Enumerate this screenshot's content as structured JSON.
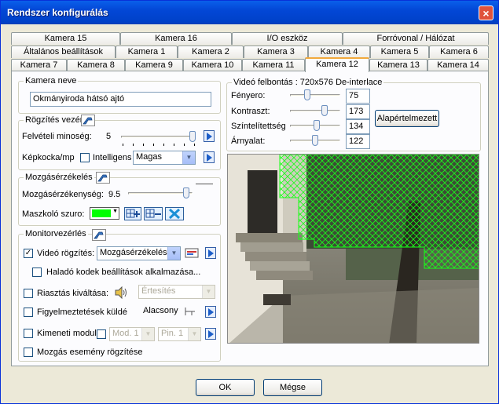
{
  "window": {
    "title": "Rendszer konfigurálás",
    "close": "×"
  },
  "tabs": {
    "row1": [
      "Kamera 15",
      "Kamera 16",
      "I/O eszköz",
      "Forróvonal / Hálózat"
    ],
    "row2": [
      "Általános beállítások",
      "Kamera 1",
      "Kamera 2",
      "Kamera 3",
      "Kamera 4",
      "Kamera 5",
      "Kamera 6"
    ],
    "row3": [
      "Kamera 7",
      "Kamera 8",
      "Kamera 9",
      "Kamera 10",
      "Kamera 11",
      "Kamera 12",
      "Kamera 13",
      "Kamera 14"
    ],
    "active": "Kamera 12"
  },
  "camera_name": {
    "label": "Kamera neve",
    "value": "Okmányiroda hátsó ajtó"
  },
  "recording": {
    "label": "Rögzítés vezér",
    "quality_label": "Felvételi minoség:",
    "quality_value": "5",
    "quality_level": 1.0,
    "fps_label": "Képkocka/mp",
    "intelligent_label": "Intelligens",
    "intelligent_checked": false,
    "fps_value": "Magas"
  },
  "motion": {
    "label": "Mozgásérzékelés",
    "sensitivity_label": "Mozgásérzékenység:",
    "sensitivity_value": "9.5",
    "sensitivity_level": 0.95,
    "mask_label": "Maszkoló szuro:",
    "mask_color": "#00ff00"
  },
  "monitor": {
    "label": "Monitorvezérlés",
    "video_rec_label": "Videó rögzítés:",
    "video_rec_checked": true,
    "video_rec_value": "Mozgásérzékelés",
    "advanced_label": "Haladó kodek beállítások alkalmazása...",
    "advanced_checked": false,
    "alarm_label": "Riasztás kiváltása:",
    "alarm_checked": false,
    "alarm_value": "Értesítés",
    "warnings_label": "Figyelmeztetések küldé",
    "warnings_checked": false,
    "warnings_level": "Alacsony",
    "output_label": "Kimeneti modul:",
    "output_checked": false,
    "output_mod": "Mod. 1",
    "output_pin": "Pin. 1",
    "motion_event_label": "Mozgás esemény rögzítése",
    "motion_event_checked": false
  },
  "video": {
    "resolution_label": "Videó felbontás : 720x576 De-interlace",
    "brightness_label": "Fényero:",
    "brightness_value": "75",
    "contrast_label": "Kontraszt:",
    "contrast_value": "173",
    "saturation_label": "Színtelítettség",
    "saturation_value": "134",
    "hue_label": "Árnyalat:",
    "hue_value": "122",
    "default_button": "Alapértelmezett"
  },
  "buttons": {
    "ok": "OK",
    "cancel": "Mégse"
  },
  "colors": {
    "titlebar": "#0347d6",
    "mask": "#00ff00",
    "accent_tab": "#f2a93b"
  }
}
